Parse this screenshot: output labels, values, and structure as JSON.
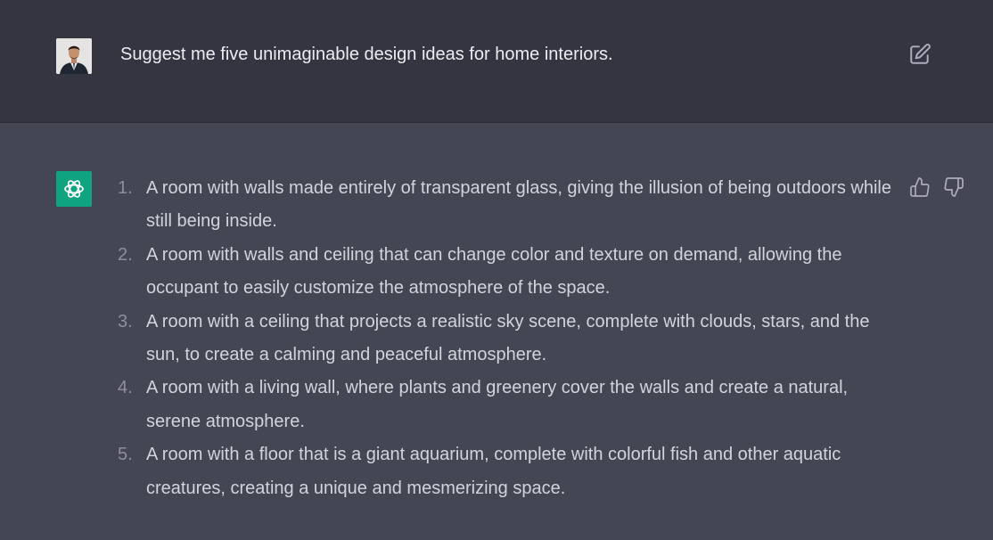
{
  "user_message": {
    "text": "Suggest me five unimaginable design ideas for home interiors."
  },
  "assistant_message": {
    "items": [
      {
        "number": "1.",
        "text": "A room with walls made entirely of transparent glass, giving the illusion of being outdoors while still being inside."
      },
      {
        "number": "2.",
        "text": "A room with walls and ceiling that can change color and texture on demand, allowing the occupant to easily customize the atmosphere of the space."
      },
      {
        "number": "3.",
        "text": "A room with a ceiling that projects a realistic sky scene, complete with clouds, stars, and the sun, to create a calming and peaceful atmosphere."
      },
      {
        "number": "4.",
        "text": "A room with a living wall, where plants and greenery cover the walls and create a natural, serene atmosphere."
      },
      {
        "number": "5.",
        "text": "A room with a floor that is a giant aquarium, complete with colorful fish and other aquatic creatures, creating a unique and mesmerizing space."
      }
    ]
  },
  "icons": {
    "edit": "edit-icon",
    "thumbs_up": "thumbs-up-icon",
    "thumbs_down": "thumbs-down-icon",
    "assistant_logo": "openai-logo-icon"
  },
  "colors": {
    "user_bg": "#343541",
    "assistant_bg": "#444654",
    "logo_bg": "#10a37f",
    "text": "#d1d5db"
  }
}
